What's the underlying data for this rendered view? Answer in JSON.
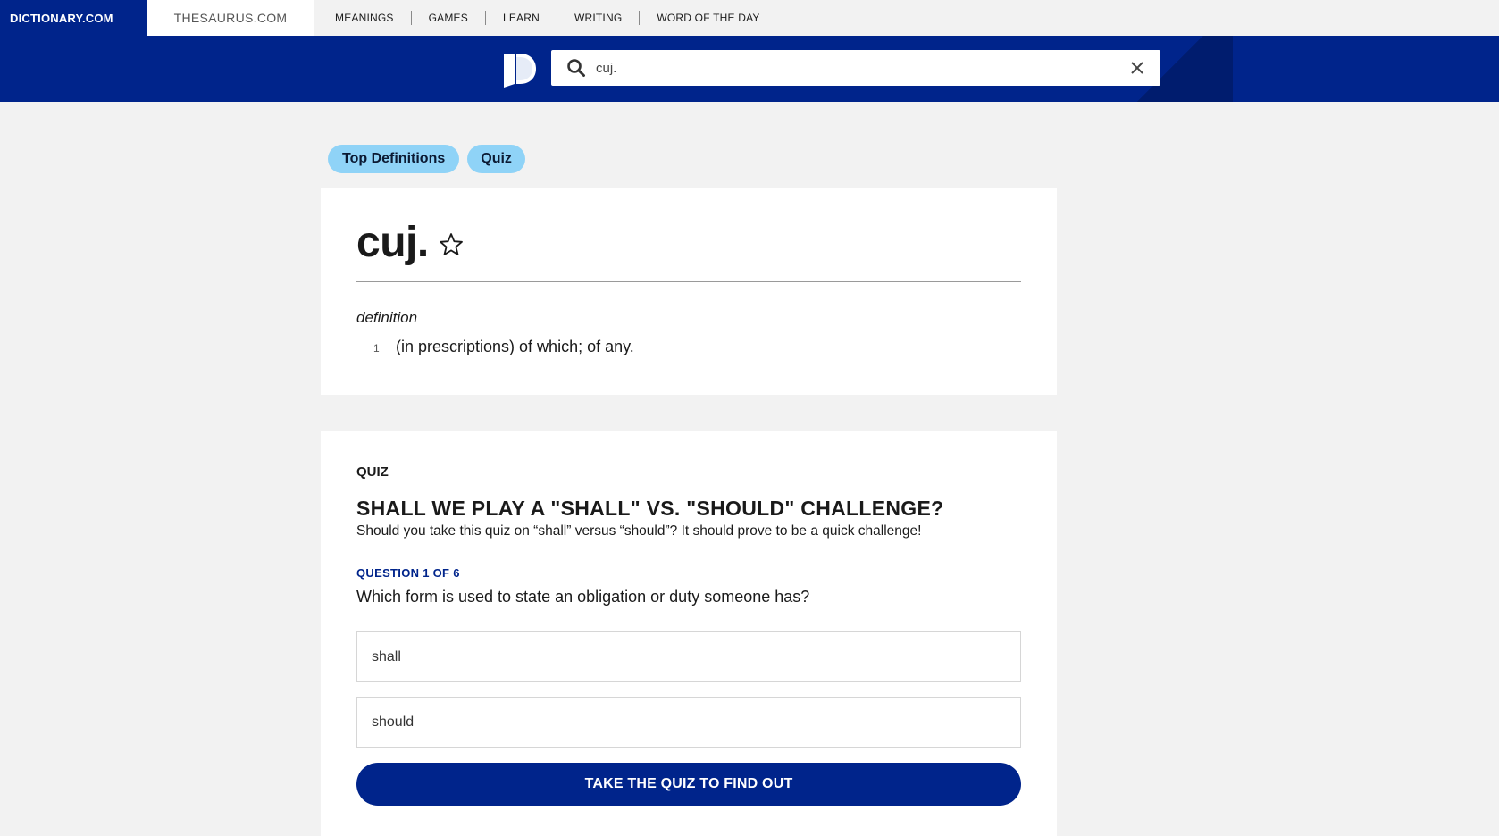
{
  "topnav": {
    "brand": "DICTIONARY.COM",
    "thesaurus": "THESAURUS.COM",
    "links": [
      "MEANINGS",
      "GAMES",
      "LEARN",
      "WRITING",
      "WORD OF THE DAY"
    ]
  },
  "search": {
    "value": "cuj.",
    "icon": "search-icon",
    "clear_icon": "close-icon"
  },
  "pills": [
    "Top Definitions",
    "Quiz"
  ],
  "entry": {
    "headword": "cuj.",
    "favorite_icon": "star-icon",
    "part_of_speech": "definition",
    "senses": [
      {
        "number": "1",
        "text": "(in prescriptions) of which; of any."
      }
    ]
  },
  "quiz": {
    "label": "QUIZ",
    "title": "SHALL WE PLAY A \"SHALL\" VS. \"SHOULD\" CHALLENGE?",
    "description": "Should you take this quiz on “shall” versus “should”? It should prove to be a quick challenge!",
    "question_count": "QUESTION 1 OF 6",
    "question": "Which form is used to state an obligation or duty someone has?",
    "options": [
      "shall",
      "should"
    ],
    "cta": "TAKE THE QUIZ TO FIND OUT"
  },
  "colors": {
    "brand_blue": "#00248b",
    "pill_blue": "#8fd3f7",
    "page_bg": "#f2f2f2"
  }
}
